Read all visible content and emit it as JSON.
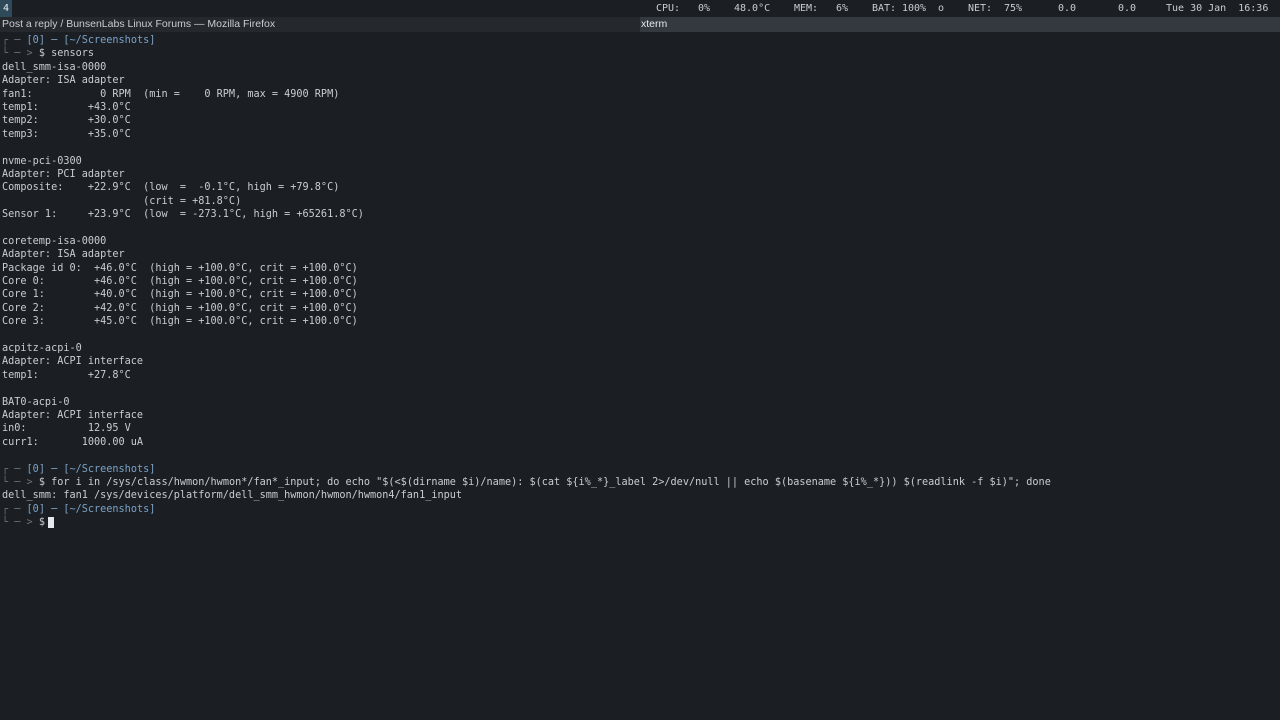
{
  "topbar": {
    "workspace": "4",
    "cpu_label": "CPU:",
    "cpu_value": "0%",
    "temp_value": "48.0°C",
    "mem_label": "MEM:",
    "mem_value": "6%",
    "bat_label": "BAT:",
    "bat_value": "100%",
    "bat_status": "o",
    "net_label": "NET:",
    "net_value": "75%",
    "net_down": "0.0",
    "net_up": "0.0",
    "datetime": "Tue 30 Jan  16:36"
  },
  "titlebar": {
    "inactive_window": "Post a reply / BunsenLabs Linux Forums — Mozilla Firefox",
    "active_window": "xterm"
  },
  "terminal": {
    "prompt1_header": "[0] ─ [~/Screenshots]",
    "prompt1_cmd": "$ sensors",
    "output1": [
      "dell_smm-isa-0000",
      "Adapter: ISA adapter",
      "fan1:           0 RPM  (min =    0 RPM, max = 4900 RPM)",
      "temp1:        +43.0°C",
      "temp2:        +30.0°C",
      "temp3:        +35.0°C",
      "",
      "nvme-pci-0300",
      "Adapter: PCI adapter",
      "Composite:    +22.9°C  (low  =  -0.1°C, high = +79.8°C)",
      "                       (crit = +81.8°C)",
      "Sensor 1:     +23.9°C  (low  = -273.1°C, high = +65261.8°C)",
      "",
      "coretemp-isa-0000",
      "Adapter: ISA adapter",
      "Package id 0:  +46.0°C  (high = +100.0°C, crit = +100.0°C)",
      "Core 0:        +46.0°C  (high = +100.0°C, crit = +100.0°C)",
      "Core 1:        +40.0°C  (high = +100.0°C, crit = +100.0°C)",
      "Core 2:        +42.0°C  (high = +100.0°C, crit = +100.0°C)",
      "Core 3:        +45.0°C  (high = +100.0°C, crit = +100.0°C)",
      "",
      "acpitz-acpi-0",
      "Adapter: ACPI interface",
      "temp1:        +27.8°C",
      "",
      "BAT0-acpi-0",
      "Adapter: ACPI interface",
      "in0:          12.95 V",
      "curr1:       1000.00 uA",
      ""
    ],
    "prompt2_header": "[0] ─ [~/Screenshots]",
    "prompt2_cmd": "$ for i in /sys/class/hwmon/hwmon*/fan*_input; do echo \"$(<$(dirname $i)/name): $(cat ${i%_*}_label 2>/dev/null || echo $(basename ${i%_*})) $(readlink -f $i)\"; done",
    "output2": "dell_smm: fan1 /sys/devices/platform/dell_smm_hwmon/hwmon/hwmon4/fan1_input",
    "prompt3_header": "[0] ─ [~/Screenshots]",
    "prompt3_cmd": "$",
    "prompt_top_glyph": "┌ ─",
    "prompt_bottom_glyph": "└ ─ >"
  }
}
